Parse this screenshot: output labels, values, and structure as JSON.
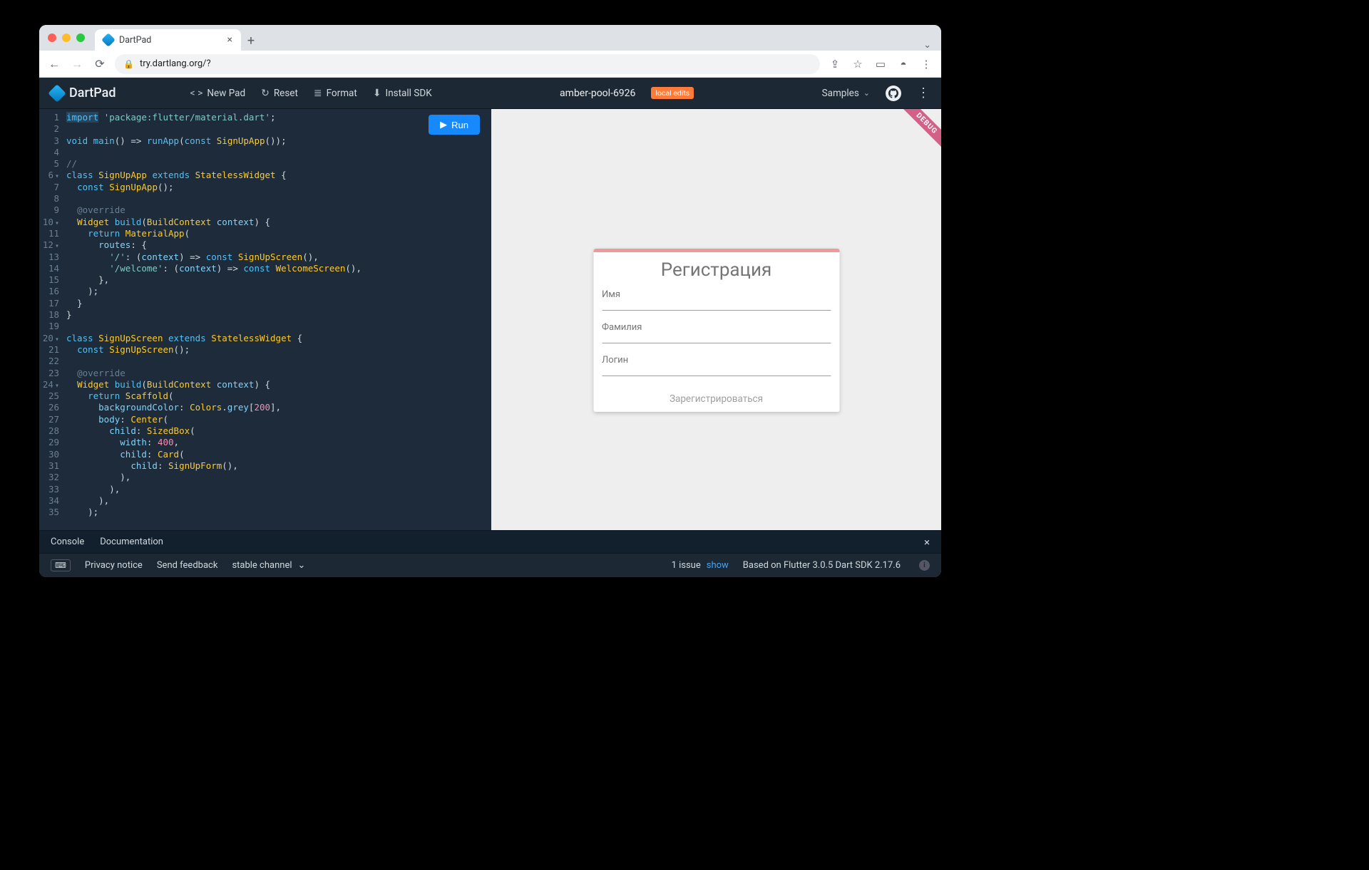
{
  "browser": {
    "tab_title": "DartPad",
    "url": "try.dartlang.org/?",
    "icons": {
      "back": "←",
      "forward": "→",
      "reload": "⟳",
      "lock": "🔒",
      "share": "⇪",
      "star": "☆",
      "ext": "▭",
      "profile": "◓",
      "more": "⋮",
      "chev": "⌄",
      "close": "×",
      "plus": "+"
    }
  },
  "appbar": {
    "brand": "DartPad",
    "new_pad": "New Pad",
    "reset": "Reset",
    "format": "Format",
    "install": "Install SDK",
    "pad_name": "amber-pool-6926",
    "badge": "local edits",
    "samples": "Samples",
    "icons": {
      "new": "< >",
      "reset": "↻",
      "format": "≣",
      "install": "⬇",
      "chev": "⌄",
      "github": "",
      "menu": "⋮"
    }
  },
  "editor": {
    "run_label": "Run",
    "lines": [
      1,
      2,
      3,
      4,
      5,
      6,
      7,
      8,
      9,
      10,
      11,
      12,
      13,
      14,
      15,
      16,
      17,
      18,
      19,
      20,
      21,
      22,
      23,
      24,
      25,
      26,
      27,
      28,
      29,
      30,
      31,
      32,
      33,
      34,
      35
    ],
    "fold_lines": [
      6,
      10,
      12,
      20,
      24
    ],
    "code_tokens": [
      [
        {
          "c": "kw cursor-hl",
          "t": "import"
        },
        {
          "c": "pn",
          "t": " "
        },
        {
          "c": "str",
          "t": "'package:flutter/material.dart'"
        },
        {
          "c": "pn",
          "t": ";"
        }
      ],
      [],
      [
        {
          "c": "kw",
          "t": "void"
        },
        {
          "c": "pn",
          "t": " "
        },
        {
          "c": "fn",
          "t": "main"
        },
        {
          "c": "pn",
          "t": "() => "
        },
        {
          "c": "fn",
          "t": "runApp"
        },
        {
          "c": "pn",
          "t": "("
        },
        {
          "c": "kw",
          "t": "const"
        },
        {
          "c": "pn",
          "t": " "
        },
        {
          "c": "cls",
          "t": "SignUpApp"
        },
        {
          "c": "pn",
          "t": "());"
        }
      ],
      [],
      [
        {
          "c": "cmt",
          "t": "//"
        }
      ],
      [
        {
          "c": "kw",
          "t": "class"
        },
        {
          "c": "pn",
          "t": " "
        },
        {
          "c": "cls",
          "t": "SignUpApp"
        },
        {
          "c": "pn",
          "t": " "
        },
        {
          "c": "kw",
          "t": "extends"
        },
        {
          "c": "pn",
          "t": " "
        },
        {
          "c": "cls",
          "t": "StatelessWidget"
        },
        {
          "c": "pn",
          "t": " {"
        }
      ],
      [
        {
          "c": "pn",
          "t": "  "
        },
        {
          "c": "kw",
          "t": "const"
        },
        {
          "c": "pn",
          "t": " "
        },
        {
          "c": "cls",
          "t": "SignUpApp"
        },
        {
          "c": "pn",
          "t": "();"
        }
      ],
      [],
      [
        {
          "c": "pn",
          "t": "  "
        },
        {
          "c": "ann",
          "t": "@override"
        }
      ],
      [
        {
          "c": "pn",
          "t": "  "
        },
        {
          "c": "typ",
          "t": "Widget"
        },
        {
          "c": "pn",
          "t": " "
        },
        {
          "c": "fn",
          "t": "build"
        },
        {
          "c": "pn",
          "t": "("
        },
        {
          "c": "typ",
          "t": "BuildContext"
        },
        {
          "c": "pn",
          "t": " "
        },
        {
          "c": "id",
          "t": "context"
        },
        {
          "c": "pn",
          "t": ") {"
        }
      ],
      [
        {
          "c": "pn",
          "t": "    "
        },
        {
          "c": "kw",
          "t": "return"
        },
        {
          "c": "pn",
          "t": " "
        },
        {
          "c": "cls",
          "t": "MaterialApp"
        },
        {
          "c": "pn",
          "t": "("
        }
      ],
      [
        {
          "c": "pn",
          "t": "      "
        },
        {
          "c": "id",
          "t": "routes"
        },
        {
          "c": "pn",
          "t": ": {"
        }
      ],
      [
        {
          "c": "pn",
          "t": "        "
        },
        {
          "c": "str",
          "t": "'/'"
        },
        {
          "c": "pn",
          "t": ": ("
        },
        {
          "c": "id",
          "t": "context"
        },
        {
          "c": "pn",
          "t": ") => "
        },
        {
          "c": "kw",
          "t": "const"
        },
        {
          "c": "pn",
          "t": " "
        },
        {
          "c": "cls",
          "t": "SignUpScreen"
        },
        {
          "c": "pn",
          "t": "(),"
        }
      ],
      [
        {
          "c": "pn",
          "t": "        "
        },
        {
          "c": "str",
          "t": "'/welcome'"
        },
        {
          "c": "pn",
          "t": ": ("
        },
        {
          "c": "id",
          "t": "context"
        },
        {
          "c": "pn",
          "t": ") => "
        },
        {
          "c": "kw",
          "t": "const"
        },
        {
          "c": "pn",
          "t": " "
        },
        {
          "c": "cls",
          "t": "WelcomeScreen"
        },
        {
          "c": "pn",
          "t": "(),"
        }
      ],
      [
        {
          "c": "pn",
          "t": "      },"
        }
      ],
      [
        {
          "c": "pn",
          "t": "    );"
        }
      ],
      [
        {
          "c": "pn",
          "t": "  }"
        }
      ],
      [
        {
          "c": "pn",
          "t": "}"
        }
      ],
      [],
      [
        {
          "c": "kw",
          "t": "class"
        },
        {
          "c": "pn",
          "t": " "
        },
        {
          "c": "cls",
          "t": "SignUpScreen"
        },
        {
          "c": "pn",
          "t": " "
        },
        {
          "c": "kw",
          "t": "extends"
        },
        {
          "c": "pn",
          "t": " "
        },
        {
          "c": "cls",
          "t": "StatelessWidget"
        },
        {
          "c": "pn",
          "t": " {"
        }
      ],
      [
        {
          "c": "pn",
          "t": "  "
        },
        {
          "c": "kw",
          "t": "const"
        },
        {
          "c": "pn",
          "t": " "
        },
        {
          "c": "cls",
          "t": "SignUpScreen"
        },
        {
          "c": "pn",
          "t": "();"
        }
      ],
      [],
      [
        {
          "c": "pn",
          "t": "  "
        },
        {
          "c": "ann",
          "t": "@override"
        }
      ],
      [
        {
          "c": "pn",
          "t": "  "
        },
        {
          "c": "typ",
          "t": "Widget"
        },
        {
          "c": "pn",
          "t": " "
        },
        {
          "c": "fn",
          "t": "build"
        },
        {
          "c": "pn",
          "t": "("
        },
        {
          "c": "typ",
          "t": "BuildContext"
        },
        {
          "c": "pn",
          "t": " "
        },
        {
          "c": "id",
          "t": "context"
        },
        {
          "c": "pn",
          "t": ") {"
        }
      ],
      [
        {
          "c": "pn",
          "t": "    "
        },
        {
          "c": "kw",
          "t": "return"
        },
        {
          "c": "pn",
          "t": " "
        },
        {
          "c": "cls",
          "t": "Scaffold"
        },
        {
          "c": "pn",
          "t": "("
        }
      ],
      [
        {
          "c": "pn",
          "t": "      "
        },
        {
          "c": "id",
          "t": "backgroundColor"
        },
        {
          "c": "pn",
          "t": ": "
        },
        {
          "c": "cls",
          "t": "Colors"
        },
        {
          "c": "pn",
          "t": "."
        },
        {
          "c": "id",
          "t": "grey"
        },
        {
          "c": "pn",
          "t": "["
        },
        {
          "c": "num",
          "t": "200"
        },
        {
          "c": "pn",
          "t": "],"
        }
      ],
      [
        {
          "c": "pn",
          "t": "      "
        },
        {
          "c": "id",
          "t": "body"
        },
        {
          "c": "pn",
          "t": ": "
        },
        {
          "c": "cls",
          "t": "Center"
        },
        {
          "c": "pn",
          "t": "("
        }
      ],
      [
        {
          "c": "pn",
          "t": "        "
        },
        {
          "c": "id",
          "t": "child"
        },
        {
          "c": "pn",
          "t": ": "
        },
        {
          "c": "cls",
          "t": "SizedBox"
        },
        {
          "c": "pn",
          "t": "("
        }
      ],
      [
        {
          "c": "pn",
          "t": "          "
        },
        {
          "c": "id",
          "t": "width"
        },
        {
          "c": "pn",
          "t": ": "
        },
        {
          "c": "num",
          "t": "400"
        },
        {
          "c": "pn",
          "t": ","
        }
      ],
      [
        {
          "c": "pn",
          "t": "          "
        },
        {
          "c": "id",
          "t": "child"
        },
        {
          "c": "pn",
          "t": ": "
        },
        {
          "c": "cls",
          "t": "Card"
        },
        {
          "c": "pn",
          "t": "("
        }
      ],
      [
        {
          "c": "pn",
          "t": "            "
        },
        {
          "c": "id",
          "t": "child"
        },
        {
          "c": "pn",
          "t": ": "
        },
        {
          "c": "cls",
          "t": "SignUpForm"
        },
        {
          "c": "pn",
          "t": "(),"
        }
      ],
      [
        {
          "c": "pn",
          "t": "          ),"
        }
      ],
      [
        {
          "c": "pn",
          "t": "        ),"
        }
      ],
      [
        {
          "c": "pn",
          "t": "      ),"
        }
      ],
      [
        {
          "c": "pn",
          "t": "    );"
        }
      ]
    ]
  },
  "preview": {
    "debug": "DEBUG",
    "title": "Регистрация",
    "fields": [
      "Имя",
      "Фамилия",
      "Логин"
    ],
    "submit": "Зарегистрироваться"
  },
  "bottom_tabs": {
    "console": "Console",
    "docs": "Documentation",
    "close": "×"
  },
  "footer": {
    "keyboard_icon": "⌨",
    "privacy": "Privacy notice",
    "feedback": "Send feedback",
    "channel": "stable channel",
    "chev": "⌄",
    "issues_count": "1 issue",
    "show": "show",
    "version": "Based on Flutter 3.0.5 Dart SDK 2.17.6",
    "info": "i"
  }
}
